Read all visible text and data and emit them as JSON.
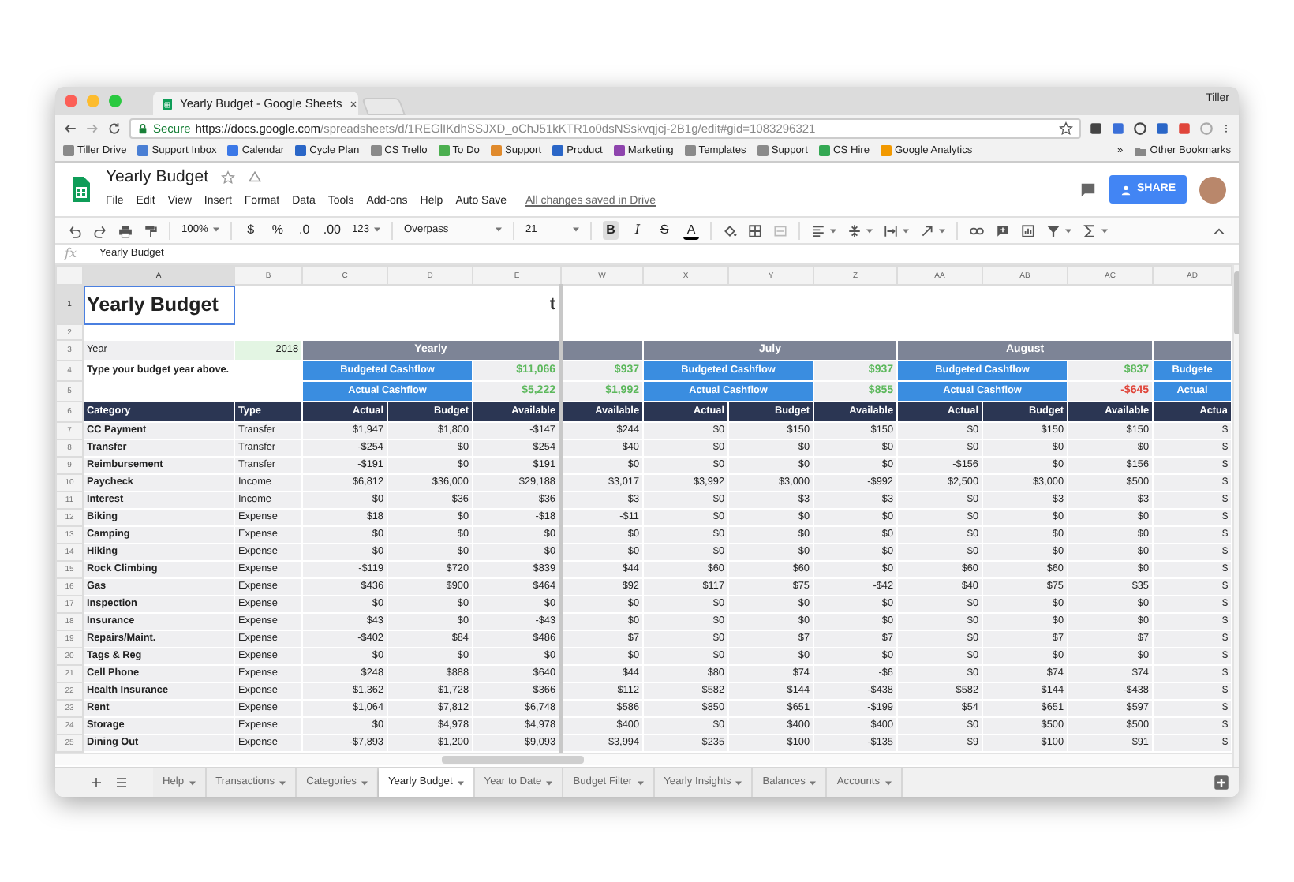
{
  "browser": {
    "tab_title": "Yearly Budget - Google Sheets",
    "profile": "Tiller",
    "secure_label": "Secure",
    "url_host": "https://docs.google.com",
    "url_path": "/spreadsheets/d/1REGlIKdhSSJXD_oChJ51kKTR1o0dsNSskvqjcj-2B1g/edit#gid=1083296321",
    "bookmarks": [
      {
        "label": "Tiller Drive",
        "color": "#8a8a8a"
      },
      {
        "label": "Support Inbox",
        "color": "#4a7fd4"
      },
      {
        "label": "Calendar",
        "color": "#3b78e7"
      },
      {
        "label": "Cycle Plan",
        "color": "#2a66c7"
      },
      {
        "label": "CS Trello",
        "color": "#8a8a8a"
      },
      {
        "label": "To Do",
        "color": "#4caf50"
      },
      {
        "label": "Support",
        "color": "#e08a2c"
      },
      {
        "label": "Product",
        "color": "#2a66c7"
      },
      {
        "label": "Marketing",
        "color": "#8e44ad"
      },
      {
        "label": "Templates",
        "color": "#8a8a8a"
      },
      {
        "label": "Support",
        "color": "#8a8a8a"
      },
      {
        "label": "CS Hire",
        "color": "#34a853"
      },
      {
        "label": "Google Analytics",
        "color": "#f29900"
      }
    ],
    "overflow": "»",
    "other_bookmarks": "Other Bookmarks"
  },
  "app": {
    "title": "Yearly Budget",
    "menus": [
      "File",
      "Edit",
      "View",
      "Insert",
      "Format",
      "Data",
      "Tools",
      "Add-ons",
      "Help",
      "Auto Save"
    ],
    "save_status": "All changes saved in Drive",
    "share": "SHARE"
  },
  "toolbar": {
    "zoom": "100%",
    "currency": "$",
    "percent": "%",
    "decrease_decimals": ".0",
    "increase_decimals": ".00",
    "more_formats": "123",
    "font": "Overpass",
    "font_size": "21",
    "bold": {
      "label": "B",
      "on": true
    },
    "italic": "I",
    "strikethrough": "S",
    "text_color": "A"
  },
  "formula_bar": {
    "label": "fx",
    "value": "Yearly Budget"
  },
  "sheet": {
    "columns": [
      "A",
      "B",
      "C",
      "D",
      "E",
      "W",
      "X",
      "Y",
      "Z",
      "AA",
      "AB",
      "AC",
      "AD"
    ],
    "rows": [
      {
        "number": "1",
        "cells": [
          {
            "kind": "title",
            "text": "Yearly Budget",
            "selected": true
          },
          {
            "kind": "empty"
          },
          {
            "kind": "empty"
          },
          {
            "kind": "empty"
          },
          {
            "kind": "logo",
            "text": "t"
          }
        ]
      },
      {
        "number": "2"
      },
      {
        "number": "3",
        "cells": [
          {
            "kind": "label",
            "text": "Year"
          },
          {
            "kind": "year",
            "text": "2018"
          },
          {
            "kind": "group",
            "text": "Yearly"
          },
          {
            "kind": "merged"
          },
          {
            "kind": "merged"
          },
          {
            "kind": "group"
          },
          {
            "kind": "group",
            "text": "July"
          },
          {
            "kind": "merged"
          },
          {
            "kind": "merged"
          },
          {
            "kind": "group",
            "text": "August"
          },
          {
            "kind": "merged"
          },
          {
            "kind": "merged"
          },
          {
            "kind": "group"
          }
        ]
      },
      {
        "number": "4",
        "cells": [
          {
            "kind": "note",
            "text": "Type your budget year above."
          },
          {
            "kind": "merged"
          },
          {
            "kind": "cashflow",
            "text": "Budgeted Cashflow"
          },
          {
            "kind": "merged"
          },
          {
            "kind": "amount",
            "color": "#5cb85c",
            "text": "$11,066"
          },
          {
            "kind": "amount",
            "color": "#5cb85c",
            "text": "$937"
          },
          {
            "kind": "cashflow",
            "text": "Budgeted Cashflow"
          },
          {
            "kind": "merged"
          },
          {
            "kind": "amount",
            "color": "#5cb85c",
            "text": "$937"
          },
          {
            "kind": "cashflow",
            "text": "Budgeted Cashflow"
          },
          {
            "kind": "merged"
          },
          {
            "kind": "amount",
            "color": "#5cb85c",
            "text": "$837"
          },
          {
            "kind": "cashflow",
            "text": "Budgete"
          }
        ]
      },
      {
        "number": "5",
        "cells": [
          {
            "kind": "empty"
          },
          {
            "kind": "empty"
          },
          {
            "kind": "cashflow",
            "text": "Actual Cashflow"
          },
          {
            "kind": "merged"
          },
          {
            "kind": "amount",
            "color": "#5cb85c",
            "text": "$5,222"
          },
          {
            "kind": "amount",
            "color": "#5cb85c",
            "text": "$1,992"
          },
          {
            "kind": "cashflow",
            "text": "Actual Cashflow"
          },
          {
            "kind": "merged"
          },
          {
            "kind": "amount",
            "color": "#5cb85c",
            "text": "$855"
          },
          {
            "kind": "cashflow",
            "text": "Actual Cashflow"
          },
          {
            "kind": "merged"
          },
          {
            "kind": "amount",
            "color": "#e0453a",
            "text": "-$645"
          },
          {
            "kind": "cashflow",
            "text": "Actual"
          }
        ]
      },
      {
        "number": "6",
        "cells": [
          {
            "kind": "header-left",
            "text": "Category"
          },
          {
            "kind": "header-left",
            "text": "Type"
          },
          {
            "kind": "header",
            "text": "Actual"
          },
          {
            "kind": "header",
            "text": "Budget"
          },
          {
            "kind": "header",
            "text": "Available"
          },
          {
            "kind": "header",
            "text": "Available"
          },
          {
            "kind": "header",
            "text": "Actual"
          },
          {
            "kind": "header",
            "text": "Budget"
          },
          {
            "kind": "header",
            "text": "Available"
          },
          {
            "kind": "header",
            "text": "Actual"
          },
          {
            "kind": "header",
            "text": "Budget"
          },
          {
            "kind": "header",
            "text": "Available"
          },
          {
            "kind": "header",
            "text": "Actua"
          }
        ]
      }
    ],
    "data_rows": [
      {
        "number": "7",
        "category": "CC Payment",
        "type": "Transfer",
        "values": [
          "$1,947",
          "$1,800",
          "-$147",
          "$244",
          "$0",
          "$150",
          "$150",
          "$0",
          "$150",
          "$150",
          "$"
        ]
      },
      {
        "number": "8",
        "category": "Transfer",
        "type": "Transfer",
        "values": [
          "-$254",
          "$0",
          "$254",
          "$40",
          "$0",
          "$0",
          "$0",
          "$0",
          "$0",
          "$0",
          "$"
        ]
      },
      {
        "number": "9",
        "category": "Reimbursement",
        "type": "Transfer",
        "values": [
          "-$191",
          "$0",
          "$191",
          "$0",
          "$0",
          "$0",
          "$0",
          "-$156",
          "$0",
          "$156",
          "$"
        ]
      },
      {
        "number": "10",
        "category": "Paycheck",
        "type": "Income",
        "values": [
          "$6,812",
          "$36,000",
          "$29,188",
          "$3,017",
          "$3,992",
          "$3,000",
          "-$992",
          "$2,500",
          "$3,000",
          "$500",
          "$"
        ]
      },
      {
        "number": "11",
        "category": "Interest",
        "type": "Income",
        "values": [
          "$0",
          "$36",
          "$36",
          "$3",
          "$0",
          "$3",
          "$3",
          "$0",
          "$3",
          "$3",
          "$"
        ]
      },
      {
        "number": "12",
        "category": "Biking",
        "type": "Expense",
        "values": [
          "$18",
          "$0",
          "-$18",
          "-$11",
          "$0",
          "$0",
          "$0",
          "$0",
          "$0",
          "$0",
          "$"
        ]
      },
      {
        "number": "13",
        "category": "Camping",
        "type": "Expense",
        "values": [
          "$0",
          "$0",
          "$0",
          "$0",
          "$0",
          "$0",
          "$0",
          "$0",
          "$0",
          "$0",
          "$"
        ]
      },
      {
        "number": "14",
        "category": "Hiking",
        "type": "Expense",
        "values": [
          "$0",
          "$0",
          "$0",
          "$0",
          "$0",
          "$0",
          "$0",
          "$0",
          "$0",
          "$0",
          "$"
        ]
      },
      {
        "number": "15",
        "category": "Rock Climbing",
        "type": "Expense",
        "values": [
          "-$119",
          "$720",
          "$839",
          "$44",
          "$60",
          "$60",
          "$0",
          "$60",
          "$60",
          "$0",
          "$"
        ]
      },
      {
        "number": "16",
        "category": "Gas",
        "type": "Expense",
        "values": [
          "$436",
          "$900",
          "$464",
          "$92",
          "$117",
          "$75",
          "-$42",
          "$40",
          "$75",
          "$35",
          "$"
        ]
      },
      {
        "number": "17",
        "category": "Inspection",
        "type": "Expense",
        "values": [
          "$0",
          "$0",
          "$0",
          "$0",
          "$0",
          "$0",
          "$0",
          "$0",
          "$0",
          "$0",
          "$"
        ]
      },
      {
        "number": "18",
        "category": "Insurance",
        "type": "Expense",
        "values": [
          "$43",
          "$0",
          "-$43",
          "$0",
          "$0",
          "$0",
          "$0",
          "$0",
          "$0",
          "$0",
          "$"
        ]
      },
      {
        "number": "19",
        "category": "Repairs/Maint.",
        "type": "Expense",
        "values": [
          "-$402",
          "$84",
          "$486",
          "$7",
          "$0",
          "$7",
          "$7",
          "$0",
          "$7",
          "$7",
          "$"
        ]
      },
      {
        "number": "20",
        "category": "Tags & Reg",
        "type": "Expense",
        "values": [
          "$0",
          "$0",
          "$0",
          "$0",
          "$0",
          "$0",
          "$0",
          "$0",
          "$0",
          "$0",
          "$"
        ]
      },
      {
        "number": "21",
        "category": "Cell Phone",
        "type": "Expense",
        "values": [
          "$248",
          "$888",
          "$640",
          "$44",
          "$80",
          "$74",
          "-$6",
          "$0",
          "$74",
          "$74",
          "$"
        ]
      },
      {
        "number": "22",
        "category": "Health Insurance",
        "type": "Expense",
        "values": [
          "$1,362",
          "$1,728",
          "$366",
          "$112",
          "$582",
          "$144",
          "-$438",
          "$582",
          "$144",
          "-$438",
          "$"
        ]
      },
      {
        "number": "23",
        "category": "Rent",
        "type": "Expense",
        "values": [
          "$1,064",
          "$7,812",
          "$6,748",
          "$586",
          "$850",
          "$651",
          "-$199",
          "$54",
          "$651",
          "$597",
          "$"
        ]
      },
      {
        "number": "24",
        "category": "Storage",
        "type": "Expense",
        "values": [
          "$0",
          "$4,978",
          "$4,978",
          "$400",
          "$0",
          "$400",
          "$400",
          "$0",
          "$500",
          "$500",
          "$"
        ]
      },
      {
        "number": "25",
        "category": "Dining Out",
        "type": "Expense",
        "values": [
          "-$7,893",
          "$1,200",
          "$9,093",
          "$3,994",
          "$235",
          "$100",
          "-$135",
          "$9",
          "$100",
          "$91",
          "$"
        ]
      }
    ]
  },
  "sheet_tabs": [
    {
      "label": "Help",
      "selected": false
    },
    {
      "label": "Transactions",
      "selected": false
    },
    {
      "label": "Categories",
      "selected": false
    },
    {
      "label": "Yearly Budget",
      "selected": true
    },
    {
      "label": "Year to Date",
      "selected": false
    },
    {
      "label": "Budget Filter",
      "selected": false
    },
    {
      "label": "Yearly Insights",
      "selected": false
    },
    {
      "label": "Balances",
      "selected": false
    },
    {
      "label": "Accounts",
      "selected": false
    }
  ]
}
